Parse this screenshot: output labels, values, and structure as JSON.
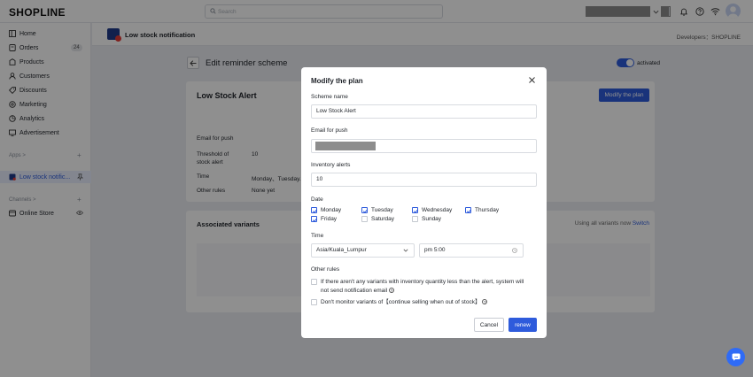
{
  "topbar": {
    "logo": "SHOPLINE",
    "search_placeholder": "Search"
  },
  "sidebar": {
    "items": [
      {
        "label": "Home",
        "icon": "home-icon"
      },
      {
        "label": "Orders",
        "icon": "orders-icon",
        "badge": "24"
      },
      {
        "label": "Products",
        "icon": "products-icon"
      },
      {
        "label": "Customers",
        "icon": "customers-icon"
      },
      {
        "label": "Discounts",
        "icon": "discounts-icon"
      },
      {
        "label": "Marketing",
        "icon": "marketing-icon"
      },
      {
        "label": "Analytics",
        "icon": "analytics-icon"
      },
      {
        "label": "Advertisement",
        "icon": "advertisement-icon"
      }
    ],
    "apps_header": "Apps >",
    "app_item": "Low stock notific...",
    "channels_header": "Channels >",
    "channel_item": "Online Store"
  },
  "header": {
    "app_title": "Low stock notification",
    "developer": "Developers：SHOPLINE"
  },
  "page": {
    "title": "Edit reminder scheme",
    "toggle_label": "activated",
    "activated": true
  },
  "card1": {
    "title": "Low Stock Alert",
    "modify_button": "Modify the plan",
    "rows": [
      {
        "label": "Email for push",
        "value": ""
      },
      {
        "label": "Threshold of stock alert",
        "value": "10"
      },
      {
        "label": "Time",
        "value": "Monday、Tuesday..."
      },
      {
        "label": "Other rules",
        "value": "None yet"
      }
    ]
  },
  "card2": {
    "title": "Associated variants",
    "status": "Using all variants now",
    "switch_link": "Switch"
  },
  "modal": {
    "title": "Modify the plan",
    "scheme_name_label": "Scheme name",
    "scheme_name_value": "Low Stock Alert",
    "email_label": "Email for push",
    "inventory_label": "Inventory alerts",
    "inventory_value": "10",
    "date_label": "Date",
    "days": [
      {
        "label": "Monday",
        "checked": true
      },
      {
        "label": "Tuesday",
        "checked": true
      },
      {
        "label": "Wednesday",
        "checked": true
      },
      {
        "label": "Thursday",
        "checked": true
      },
      {
        "label": "Friday",
        "checked": true
      },
      {
        "label": "Saturday",
        "checked": false
      },
      {
        "label": "Sunday",
        "checked": false
      }
    ],
    "time_label": "Time",
    "timezone": "Asia/Kuala_Lumpur",
    "time_value": "pm 5:00",
    "other_rules_label": "Other rules",
    "rule1": "If there aren't any variants with inventory quantity less than the alert, system will not send notification email",
    "rule2": "Don't monitor variants of【continue selling when out of stock】",
    "cancel": "Cancel",
    "renew": "renew"
  },
  "colors": {
    "primary": "#2e5bdc",
    "overlay": "rgba(0,0,0,0.44)",
    "chat": "#2f6bf6"
  }
}
